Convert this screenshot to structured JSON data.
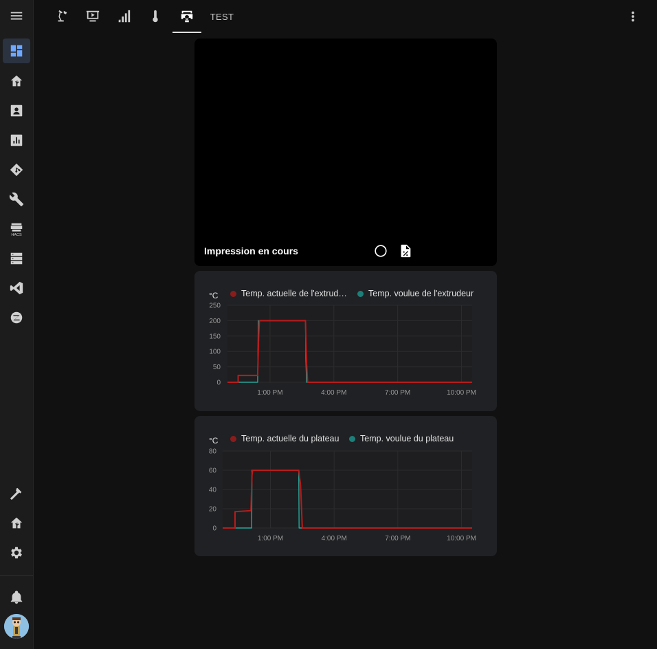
{
  "sidebar": {
    "items": [
      {
        "icon": "view-dashboard-icon",
        "active": true
      },
      {
        "icon": "home-assistant-icon"
      },
      {
        "icon": "account-box-icon"
      },
      {
        "icon": "chart-box-icon"
      },
      {
        "icon": "git-icon"
      },
      {
        "icon": "wrench-icon"
      },
      {
        "icon": "hacs-icon",
        "caption": "HACS"
      },
      {
        "icon": "server-icon"
      },
      {
        "icon": "vscode-icon"
      },
      {
        "icon": "zigbee-icon"
      }
    ],
    "bottom": [
      {
        "icon": "hammer-icon"
      },
      {
        "icon": "home-assistant-icon"
      },
      {
        "icon": "cog-icon"
      },
      {
        "icon": "bell-icon"
      }
    ]
  },
  "topbar": {
    "tabs": [
      {
        "icon": "desk-lamp-icon"
      },
      {
        "icon": "projector-screen-icon"
      },
      {
        "icon": "signal-bars-icon"
      },
      {
        "icon": "thermometer-icon"
      },
      {
        "icon": "printer-3d-icon",
        "active": true
      }
    ],
    "test_label": "TEST",
    "menu_icon": "dots-vertical-icon"
  },
  "camera": {
    "title": "Impression en cours"
  },
  "charts": [
    {
      "unit": "°C",
      "legend": [
        "Temp. actuelle de l'extrud…",
        "Temp. voulue de l'extrudeur"
      ],
      "yticks": [
        "250",
        "200",
        "150",
        "100",
        "50",
        "0"
      ],
      "xticks": [
        "1:00 PM",
        "4:00 PM",
        "7:00 PM",
        "10:00 PM"
      ]
    },
    {
      "unit": "°C",
      "legend": [
        "Temp. actuelle du plateau",
        "Temp. voulue du plateau"
      ],
      "yticks": [
        "80",
        "60",
        "40",
        "20",
        "0"
      ],
      "xticks": [
        "1:00 PM",
        "4:00 PM",
        "7:00 PM",
        "10:00 PM"
      ]
    }
  ],
  "colors": {
    "actual": "#b71c1c",
    "target": "#26a69a",
    "accent": "#6fa8ff"
  },
  "chart_data": [
    {
      "type": "line",
      "ylim": [
        0,
        250
      ],
      "xlim": [
        "11:00 AM",
        "10:30 PM"
      ],
      "series": [
        {
          "name": "Temp. actuelle de l'extrud…",
          "x": [
            "11:00 AM",
            "11:30 AM",
            "11:30 AM",
            "12:25 PM",
            "12:28 PM",
            "12:30 PM",
            "2:40 PM",
            "2:43 PM",
            "2:46 PM",
            "10:30 PM"
          ],
          "y": [
            0,
            0,
            22,
            22,
            150,
            200,
            200,
            60,
            0,
            0
          ]
        },
        {
          "name": "Temp. voulue de l'extrudeur",
          "x": [
            "11:00 AM",
            "12:25 PM",
            "12:27 PM",
            "2:40 PM",
            "2:41 PM",
            "2:43 PM",
            "10:30 PM"
          ],
          "y": [
            0,
            0,
            200,
            200,
            80,
            0,
            0
          ]
        }
      ]
    },
    {
      "type": "line",
      "ylim": [
        0,
        80
      ],
      "xlim": [
        "10:45 AM",
        "10:30 PM"
      ],
      "series": [
        {
          "name": "Temp. actuelle du plateau",
          "x": [
            "10:45 AM",
            "11:20 AM",
            "11:20 AM",
            "12:05 PM",
            "12:08 PM",
            "12:10 PM",
            "2:20 PM",
            "2:25 PM",
            "2:30 PM",
            "10:30 PM"
          ],
          "y": [
            0,
            0,
            17,
            18,
            55,
            60,
            60,
            45,
            0,
            0
          ]
        },
        {
          "name": "Temp. voulue du plateau",
          "x": [
            "10:45 AM",
            "12:07 PM",
            "12:08 PM",
            "2:20 PM",
            "2:21 PM",
            "10:30 PM"
          ],
          "y": [
            0,
            0,
            60,
            60,
            0,
            0
          ]
        }
      ]
    }
  ]
}
